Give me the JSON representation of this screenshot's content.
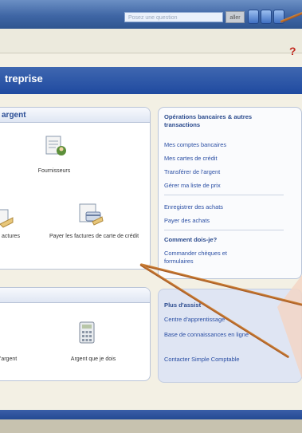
{
  "search": {
    "placeholder": "Posez une question",
    "go_label": "aller"
  },
  "help_label": "?",
  "banner": {
    "title": "treprise"
  },
  "money_panel": {
    "title": "argent",
    "items": [
      {
        "label": "Fournisseurs",
        "icon": "supplier-icon"
      },
      {
        "label": "actures",
        "icon": "invoice-icon"
      },
      {
        "label": "Payer les factures de carte de crédit",
        "icon": "credit-card-bill-icon"
      }
    ]
  },
  "debt_panel": {
    "items": [
      {
        "label": "'argent",
        "icon": "money-icon"
      },
      {
        "label": "Argent que je dois",
        "icon": "calculator-icon"
      }
    ]
  },
  "right_panel": {
    "heading1": "Opérations bancaires & autres transactions",
    "links1": [
      "Mes comptes bancaires",
      "Mes cartes de crédit",
      "Transférer de l'argent",
      "Gérer ma liste de prix"
    ],
    "links2": [
      "Enregistrer des achats",
      "Payer des achats"
    ],
    "heading2": "Comment dois-je?",
    "links3": [
      "Commander chèques et formulaires"
    ]
  },
  "help_panel": {
    "heading": "Plus d'assist",
    "links": [
      "Centre d'apprentissage",
      "Base de connaissances en ligne",
      "Contacter Simple Comptable"
    ]
  },
  "colors": {
    "accent_blue": "#2f5590",
    "link": "#2b4fa4",
    "arrow": "#b9642a"
  }
}
